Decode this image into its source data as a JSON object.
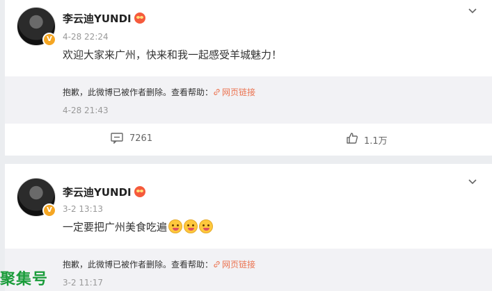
{
  "posts": [
    {
      "author": "李云迪YUNDI",
      "time": "4-28 22:24",
      "content": "欢迎大家来广州，快来和我一起感受羊城魅力！",
      "deleted_notice": {
        "text": "抱歉，此微博已被作者删除。查看帮助：",
        "link": "网页链接",
        "time": "4-28 21:43"
      },
      "actions": {
        "comments": "7261",
        "likes": "1.1万"
      }
    },
    {
      "author": "李云迪YUNDI",
      "time": "3-2 13:13",
      "content": "一定要把广州美食吃遍",
      "emoji_count": 3,
      "deleted_notice": {
        "text": "抱歉，此微博已被作者删除。查看帮助：",
        "link": "网页链接",
        "time": "3-2 11:17"
      }
    }
  ],
  "watermark": "聚集号",
  "colors": {
    "link": "#eb7350",
    "deleted_bg": "#f2f2f5",
    "page_bg": "#ebedf0"
  },
  "icons": [
    "chevron-down-icon",
    "comment-icon",
    "like-icon",
    "link-icon",
    "verified-badge-icon"
  ]
}
